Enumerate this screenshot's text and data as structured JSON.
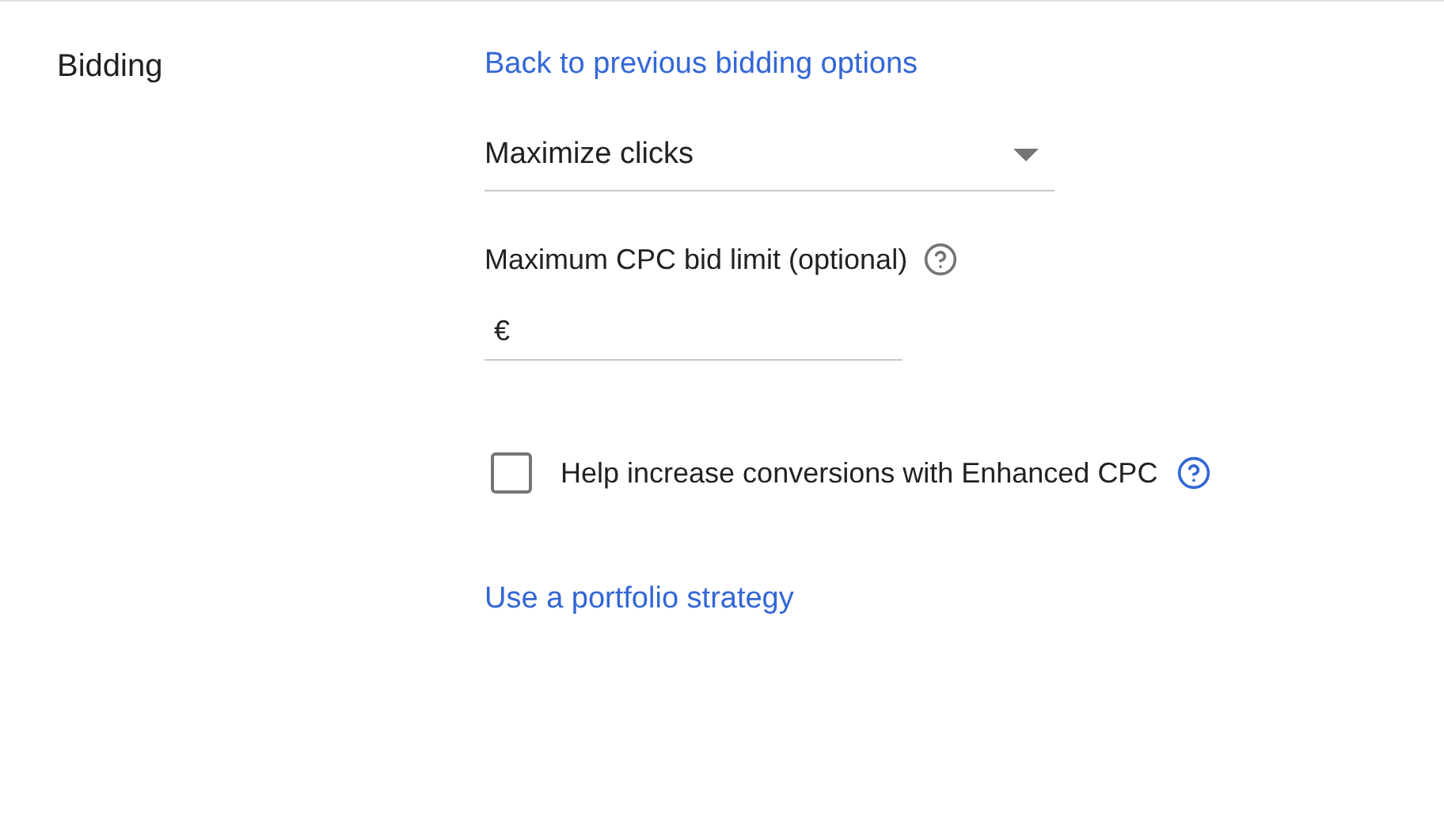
{
  "section_title": "Bidding",
  "back_link": "Back to previous bidding options",
  "strategy_dropdown": {
    "value": "Maximize clicks"
  },
  "cpc_limit": {
    "label": "Maximum CPC bid limit (optional)",
    "currency": "€"
  },
  "enhanced_cpc": {
    "label": "Help increase conversions with Enhanced CPC",
    "checked": false
  },
  "portfolio_link": "Use a portfolio strategy"
}
